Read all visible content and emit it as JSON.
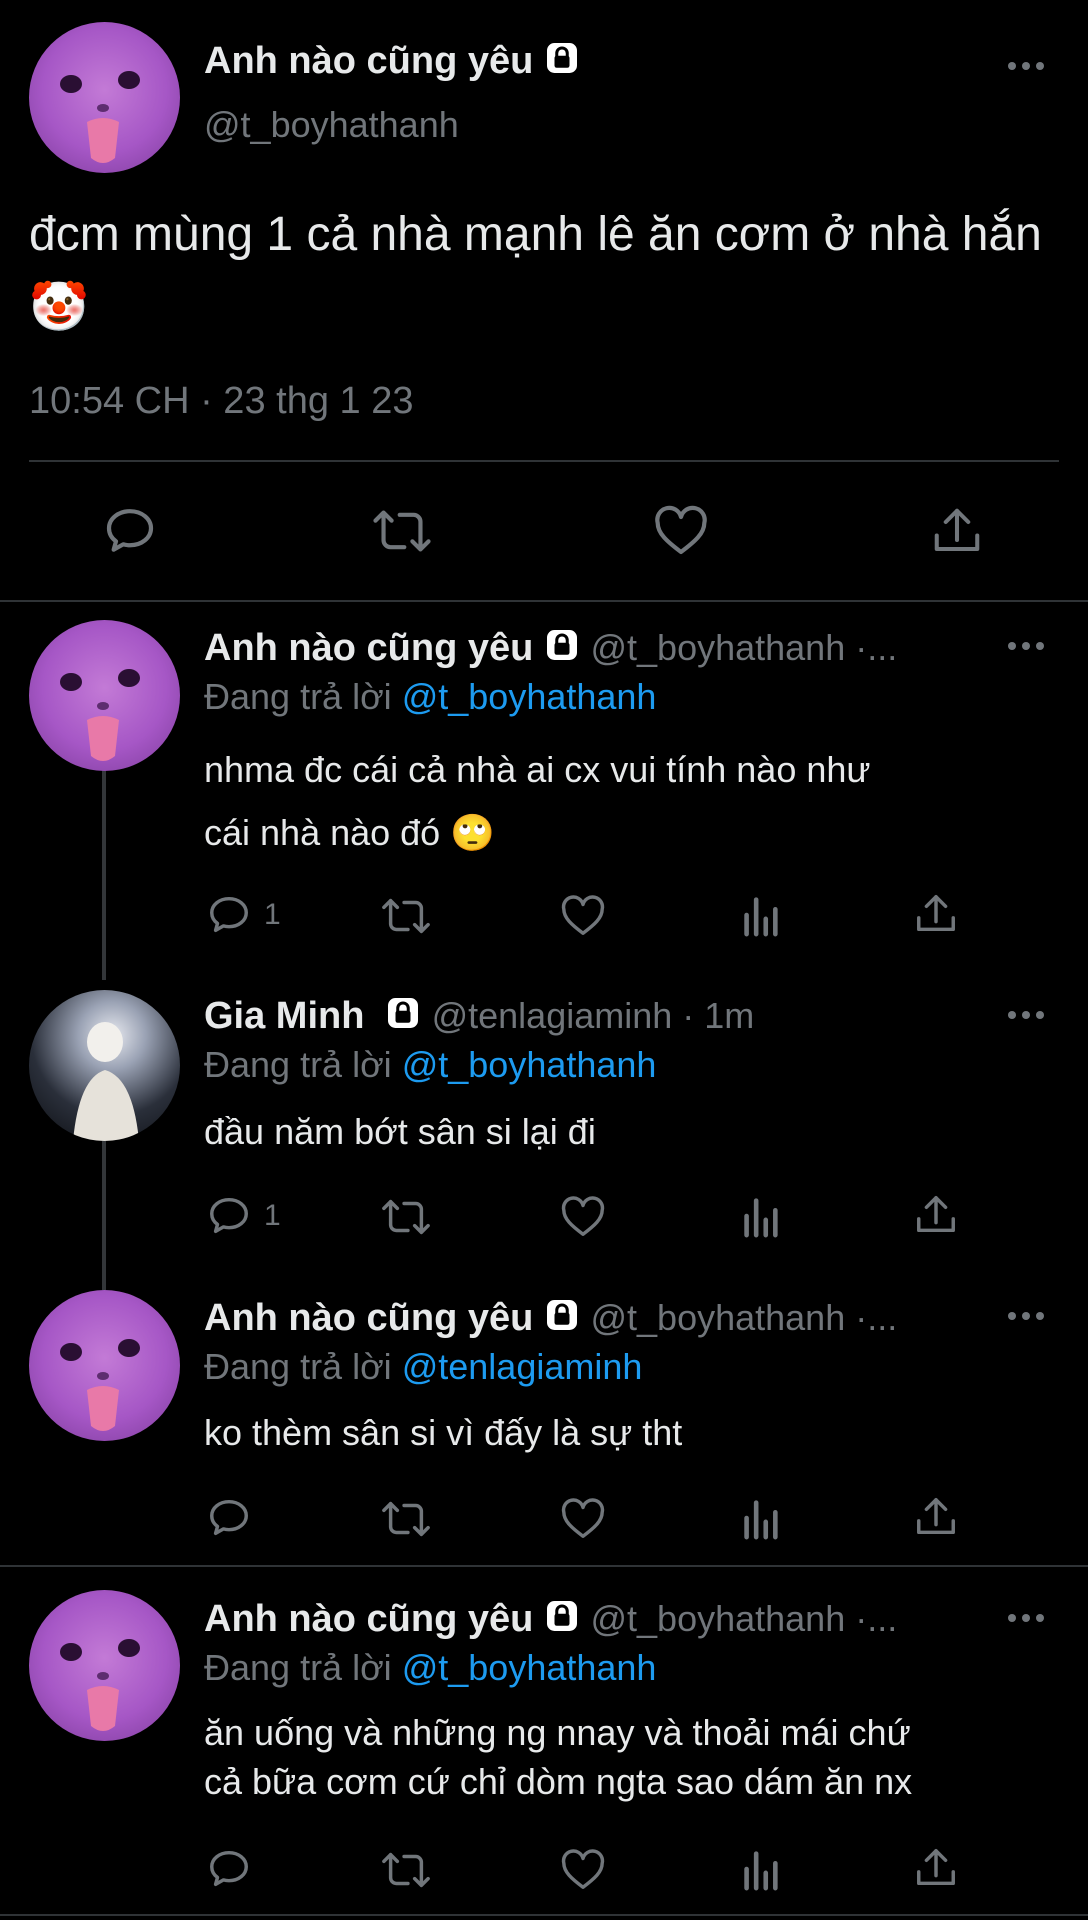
{
  "main_tweet": {
    "display_name": "Anh nào cũng yêu",
    "handle": "@t_boyhathanh",
    "text": "đcm mùng 1 cả nhà mạnh lê ăn cơm ở nhà hắn 🤡",
    "timestamp": "10:54 CH · 23 thg 1 23"
  },
  "replies": [
    {
      "display_name": "Anh nào cũng yêu",
      "handle_meta": "@t_boyhathanh ·...",
      "replying_prefix": "Đang trả lời",
      "replying_to": "@t_boyhathanh",
      "text_lines": [
        "nhma đc cái cả nhà ai cx vui tính nào như",
        "cái nhà nào đó 🙄"
      ],
      "reply_count": "1"
    },
    {
      "display_name": "Gia Minh",
      "handle_meta": "@tenlagiaminh · 1m",
      "replying_prefix": "Đang trả lời",
      "replying_to": "@t_boyhathanh",
      "text_lines": [
        "đầu năm bớt sân si lại đi"
      ],
      "reply_count": "1"
    },
    {
      "display_name": "Anh nào cũng yêu",
      "handle_meta": "@t_boyhathanh ·...",
      "replying_prefix": "Đang trả lời",
      "replying_to": "@tenlagiaminh",
      "text_lines": [
        "ko thèm sân si vì đấy là sự tht"
      ],
      "reply_count": ""
    },
    {
      "display_name": "Anh nào cũng yêu",
      "handle_meta": "@t_boyhathanh ·...",
      "replying_prefix": "Đang trả lời",
      "replying_to": "@t_boyhathanh",
      "text_lines": [
        "ăn uống và những ng nnay và thoải mái chứ",
        "cả bữa cơm cứ chỉ dòm ngta sao dám ăn nx"
      ],
      "reply_count": ""
    }
  ],
  "colors": {
    "background": "#000000",
    "text": "#e7e9ea",
    "muted": "#71767b",
    "link": "#1d9bf0",
    "divider": "#2f3336"
  },
  "icons": [
    "lock-icon",
    "more-icon",
    "reply-icon",
    "retweet-icon",
    "like-icon",
    "share-icon",
    "views-icon"
  ]
}
